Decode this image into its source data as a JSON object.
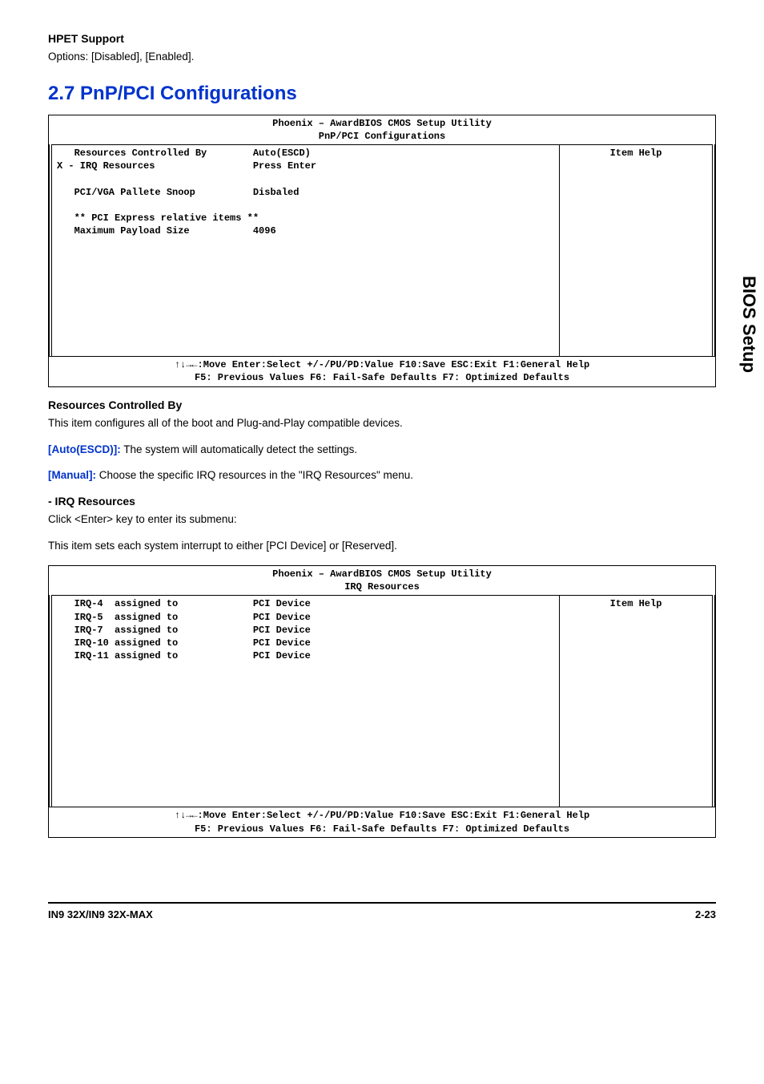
{
  "section": {
    "hpet_title": "HPET Support",
    "hpet_text": "Options: [Disabled], [Enabled].",
    "pnp_heading": "2.7 PnP/PCI Configurations",
    "resources_heading": "Resources Controlled By",
    "resources_desc": "This item configures all of the boot and Plug-and-Play compatible devices.",
    "auto_escd_label": "[Auto(ESCD)]:",
    "auto_escd_text": " The system will automatically detect the settings.",
    "manual_label": "[Manual]:",
    "manual_text": " Choose the specific IRQ resources in the \"IRQ Resources\" menu.",
    "irq_res_title": "-   IRQ Resources",
    "irq_res_text1": "Click <Enter> key to enter its submenu:",
    "irq_res_text2": "This item sets each system interrupt to either [PCI Device] or [Reserved]."
  },
  "bios1": {
    "title": "Phoenix – AwardBIOS CMOS Setup Utility",
    "subtitle": "PnP/PCI Configurations",
    "left": "   Resources Controlled By        Auto(ESCD)\nX - IRQ Resources                 Press Enter\n\n   PCI/VGA Pallete Snoop          Disbaled\n\n   ** PCI Express relative items **\n   Maximum Payload Size           4096\n\n\n\n\n\n\n\n\n\n",
    "right": "Item Help",
    "footer1": "↑↓→←:Move  Enter:Select  +/-/PU/PD:Value  F10:Save  ESC:Exit  F1:General Help",
    "footer2": "F5: Previous Values   F6: Fail-Safe Defaults   F7: Optimized Defaults"
  },
  "bios2": {
    "title": "Phoenix – AwardBIOS CMOS Setup Utility",
    "subtitle": "IRQ Resources",
    "left": "   IRQ-4  assigned to             PCI Device\n   IRQ-5  assigned to             PCI Device\n   IRQ-7  assigned to             PCI Device\n   IRQ-10 assigned to             PCI Device\n   IRQ-11 assigned to             PCI Device\n\n\n\n\n\n\n\n\n\n\n\n",
    "right": "Item Help",
    "footer1": "↑↓→←:Move  Enter:Select  +/-/PU/PD:Value  F10:Save  ESC:Exit  F1:General Help",
    "footer2": "F5: Previous Values   F6: Fail-Safe Defaults   F7: Optimized Defaults"
  },
  "side_tab": "BIOS Setup",
  "footer": {
    "left": "IN9 32X/IN9 32X-MAX",
    "right": "2-23"
  }
}
